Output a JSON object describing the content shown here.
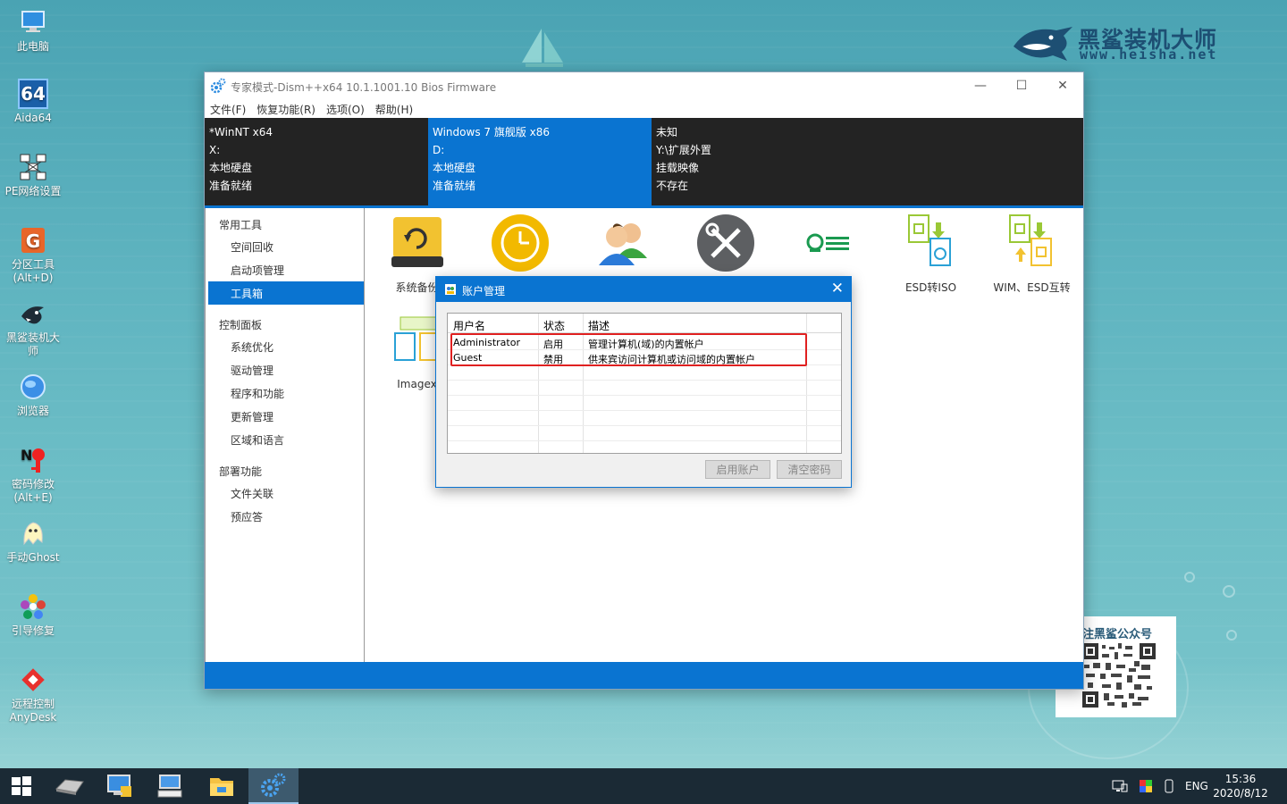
{
  "desktop": {
    "icons": [
      {
        "label": "此电脑",
        "icon": "computer-icon"
      },
      {
        "label": "Aida64",
        "icon": "aida64-icon",
        "glyph": "64"
      },
      {
        "label": "PE网络设置",
        "icon": "network-icon"
      },
      {
        "label": "分区工具",
        "sub": "(Alt+D)",
        "icon": "partition-icon"
      },
      {
        "label": "黑鲨装机大",
        "sub": "师",
        "icon": "shark-icon"
      },
      {
        "label": "浏览器",
        "icon": "browser-icon"
      },
      {
        "label": "密码修改",
        "sub": "(Alt+E)",
        "icon": "password-icon"
      },
      {
        "label": "手动Ghost",
        "icon": "ghost-icon"
      },
      {
        "label": "引导修复",
        "icon": "boot-repair-icon"
      },
      {
        "label": "远程控制",
        "sub": "AnyDesk",
        "icon": "anydesk-icon"
      }
    ],
    "brand": {
      "name": "黑鲨装机大师",
      "url": "www.heisha.net"
    },
    "qr": {
      "title": "注黑鲨公众号"
    }
  },
  "window": {
    "title": "专家模式-Dism++x64 10.1.1001.10 Bios Firmware",
    "controls": {
      "minimize": "—",
      "maximize": "☐",
      "close": "✕"
    },
    "menu": [
      "文件(F)",
      "恢复功能(R)",
      "选项(O)",
      "帮助(H)"
    ],
    "info": [
      {
        "name": "*WinNT x64",
        "drive": "X:",
        "type": "本地硬盘",
        "status": "准备就绪"
      },
      {
        "name": "Windows 7 旗舰版 x86",
        "drive": "D:",
        "type": "本地硬盘",
        "status": "准备就绪"
      },
      {
        "name": "未知",
        "drive": "Y:\\扩展外置",
        "type": "挂载映像",
        "status": "不存在"
      }
    ],
    "sidebar": {
      "groups": [
        {
          "title": "常用工具",
          "items": [
            "空间回收",
            "启动项管理",
            "工具箱"
          ]
        },
        {
          "title": "控制面板",
          "items": [
            "系统优化",
            "驱动管理",
            "程序和功能",
            "更新管理",
            "区域和语言"
          ]
        },
        {
          "title": "部署功能",
          "items": [
            "文件关联",
            "预应答"
          ]
        }
      ],
      "selected": "工具箱"
    },
    "tools": [
      {
        "label": "系统备份",
        "icon": "backup-drive-icon"
      },
      {
        "label": "",
        "icon": "restore-clock-icon"
      },
      {
        "label": "",
        "icon": "users-icon"
      },
      {
        "label": "",
        "icon": "tools-icon"
      },
      {
        "label": "",
        "icon": "list-settings-icon"
      },
      {
        "label": "ESD转ISO",
        "icon": "esd-iso-icon"
      },
      {
        "label": "WIM、ESD互转",
        "icon": "wim-esd-icon"
      },
      {
        "label": "Imagex",
        "icon": "imagex-icon"
      }
    ]
  },
  "dialog": {
    "title": "账户管理",
    "close": "✕",
    "columns": [
      "用户名",
      "状态",
      "描述"
    ],
    "rows": [
      {
        "user": "Administrator",
        "state": "启用",
        "desc": "管理计算机(域)的内置帐户"
      },
      {
        "user": "Guest",
        "state": "禁用",
        "desc": "供来宾访问计算机或访问域的内置帐户"
      }
    ],
    "buttons": {
      "enable": "启用账户",
      "clear": "清空密码"
    }
  },
  "taskbar": {
    "lang": "ENG",
    "time": "15:36",
    "date": "2020/8/12"
  }
}
